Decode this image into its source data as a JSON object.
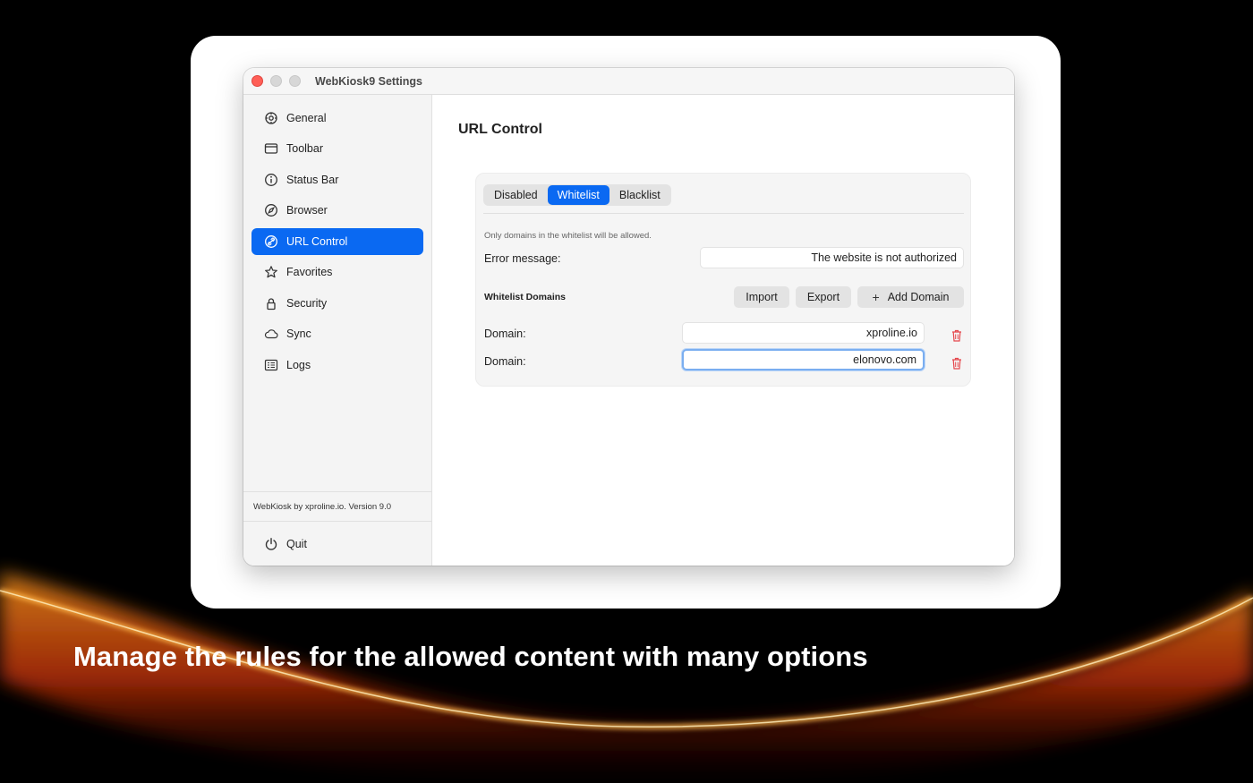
{
  "window": {
    "title": "WebKiosk9 Settings"
  },
  "sidebar": {
    "items": [
      {
        "label": "General",
        "icon": "gear-icon"
      },
      {
        "label": "Toolbar",
        "icon": "toolbar-icon"
      },
      {
        "label": "Status Bar",
        "icon": "info-icon"
      },
      {
        "label": "Browser",
        "icon": "compass-icon"
      },
      {
        "label": "URL Control",
        "icon": "link-icon",
        "active": true
      },
      {
        "label": "Favorites",
        "icon": "star-icon"
      },
      {
        "label": "Security",
        "icon": "lock-icon"
      },
      {
        "label": "Sync",
        "icon": "cloud-icon"
      },
      {
        "label": "Logs",
        "icon": "logs-icon"
      }
    ],
    "version": "WebKiosk by xproline.io. Version 9.0",
    "quit_label": "Quit"
  },
  "main": {
    "title": "URL Control",
    "segments": [
      "Disabled",
      "Whitelist",
      "Blacklist"
    ],
    "selected_segment": "Whitelist",
    "hint": "Only domains in the whitelist will be allowed.",
    "error_label": "Error message:",
    "error_value": "The website is not authorized",
    "whitelist_label": "Whitelist Domains",
    "import_label": "Import",
    "export_label": "Export",
    "add_label": "Add Domain",
    "domains": [
      {
        "label": "Domain:",
        "value": "xproline.io"
      },
      {
        "label": "Domain:",
        "value": "elonovo.com"
      }
    ]
  },
  "caption": "Manage the rules for the allowed content with many options",
  "colors": {
    "accent": "#0a69f2",
    "delete": "#e5484d",
    "focus": "#7aaef0"
  }
}
